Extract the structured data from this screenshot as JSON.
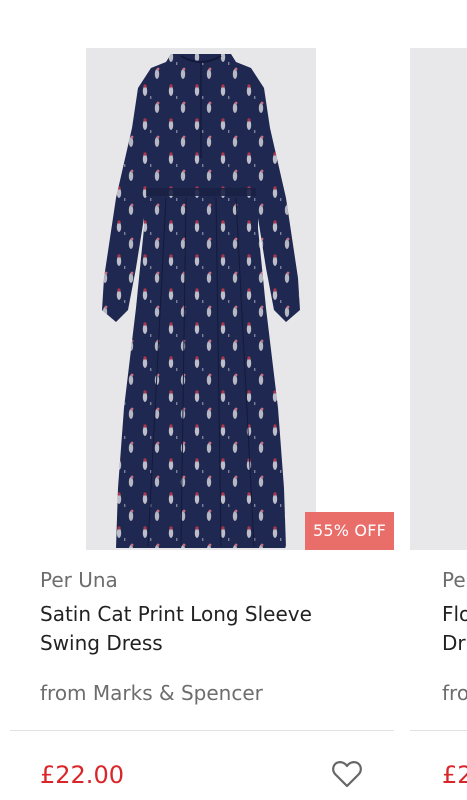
{
  "products": [
    {
      "image_alt": "Satin Cat Print Long Sleeve Swing Dress",
      "discount_badge": "55% OFF",
      "brand": "Per Una",
      "title_lines": [
        "Satin Cat Print Long Sleeve",
        "Swing Dress"
      ],
      "retailer": "from Marks & Spencer",
      "price": "£22.00",
      "wishlist_icon": "heart-outline-icon"
    },
    {
      "brand": "Pe",
      "title_lines": [
        "Flo",
        "Dr"
      ],
      "retailer": "fro",
      "price": "£2"
    }
  ],
  "colors": {
    "badge_background": "#e96e6a",
    "price": "#d9262a",
    "dress_navy": "#1f2850",
    "muted_text": "#6d6d6d"
  }
}
